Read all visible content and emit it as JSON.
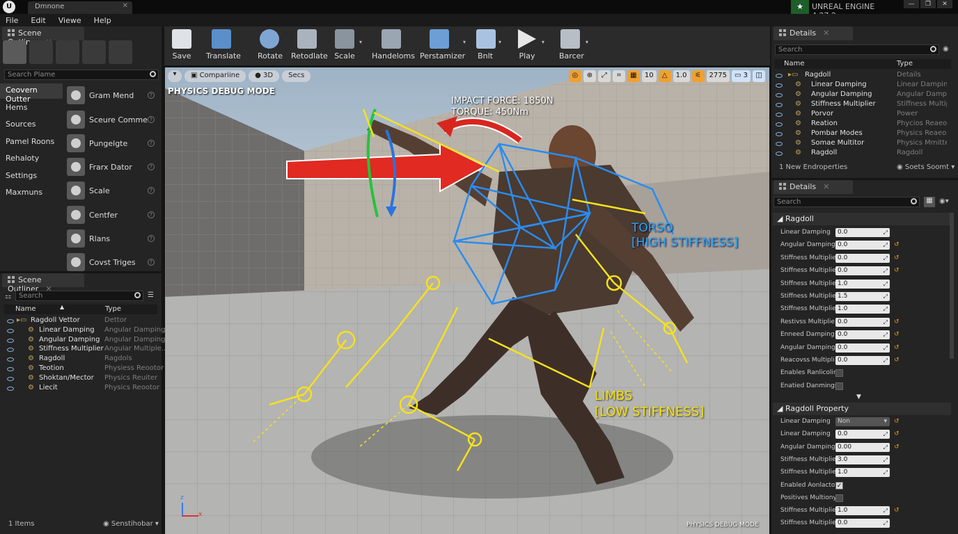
{
  "window": {
    "tab_title": "Dmnone",
    "engine_version": "UNREAL ENGINE 4.27.2"
  },
  "menu": [
    "File",
    "Edit",
    "Viewe",
    "Help"
  ],
  "place_panel": {
    "tab_label": "Scene Outliner",
    "search_placeholder": "Search Plame",
    "categories": [
      "Ceovern Outter",
      "Hems",
      "Sources",
      "Pamel Roons",
      "Rehaloty",
      "Settings",
      "Maxmuns"
    ],
    "items": [
      "Gram Mend",
      "Sceure Comme...",
      "Pungelgte",
      "Frarx Dator",
      "Scale",
      "Centfer",
      "Rlans",
      "Covst Triges"
    ]
  },
  "outliner": {
    "tab_label": "Scene Outliner",
    "search_placeholder": "Search",
    "col_name": "Name",
    "col_type": "Type",
    "rows": [
      {
        "name": "Ragdoll Vettor",
        "type": "Dettor"
      },
      {
        "name": "Linear Damping",
        "type": "Angular Damping"
      },
      {
        "name": "Angular Damping",
        "type": "Angular Damping"
      },
      {
        "name": "Stiffness Multiplier",
        "type": "Angular Multiple..."
      },
      {
        "name": "Ragdoll",
        "type": "Ragdols"
      },
      {
        "name": "Teotion",
        "type": "Physiess Reootor"
      },
      {
        "name": "Shoktan/Mector",
        "type": "Physics Reuiter"
      },
      {
        "name": "Liecit",
        "type": "Physics Reootor"
      }
    ],
    "footer_count": "1 Items",
    "footer_view": "Senstihobar"
  },
  "toolbar": {
    "buttons": [
      "Save",
      "Translate",
      "Rotate",
      "Retodlate",
      "Scale",
      "Handeloms",
      "Perstamizer",
      "Bnlt",
      "Play",
      "Barcer"
    ]
  },
  "viewport": {
    "pill_compare": "Compariine",
    "pill_3d": "3D",
    "pill_secs": "Secs",
    "snap_grid": "10",
    "snap_scale": "1.0",
    "cam_speed": "2775",
    "screen_count": "3",
    "mode_label": "PHYSICS DEBUG MODE",
    "impact_force": "IMPACT FORCE: 1850N",
    "torque": "TORQUE: 450Nm",
    "torso_label_1": "TORSO",
    "torso_label_2": "[HIGH STIFFNESS]",
    "limbs_label_1": "LIMBS",
    "limbs_label_2": "[LOW STIFFNESS]",
    "bottom_label": "PHYSICS DEBUG MODE",
    "axes": [
      "z",
      "x"
    ]
  },
  "details_top": {
    "tab_label": "Details",
    "search_placeholder": "Search",
    "col_name": "Name",
    "col_type": "Type",
    "rows": [
      {
        "name": "Ragdoll",
        "type": "Details"
      },
      {
        "name": "Linear Damping",
        "type": "Linear Damping"
      },
      {
        "name": "Angular Damping",
        "type": "Angular Dampin"
      },
      {
        "name": "Stiffness Multiplier",
        "type": "Stiffness Multipl"
      },
      {
        "name": "Porvor",
        "type": "Power"
      },
      {
        "name": "Reation",
        "type": "Phycios Reaeos"
      },
      {
        "name": "Pombar Modes",
        "type": "Physics Reaeos"
      },
      {
        "name": "Somae Multitor",
        "type": "Physics Mmitter"
      },
      {
        "name": "Ragdoll",
        "type": "Ragdoll"
      }
    ],
    "footer_new": "1 New Endroperties",
    "footer_sort": "Soets Soomt"
  },
  "details_bottom": {
    "tab_label": "Details",
    "search_placeholder": "Search",
    "section_ragdoll": "Ragdoll",
    "ragdoll_rows": [
      {
        "label": "Linear Damping",
        "value": "0.0",
        "kind": "num",
        "reset": false
      },
      {
        "label": "Angular Damping",
        "value": "0.0",
        "kind": "num",
        "reset": true
      },
      {
        "label": "Stiffness Multiplie",
        "value": "0.0",
        "kind": "num",
        "reset": true
      },
      {
        "label": "Stiffness Multiplie",
        "value": "0.0",
        "kind": "num",
        "reset": true
      },
      {
        "label": "Stiffness Multiplie",
        "value": "1.0",
        "kind": "num",
        "reset": false
      },
      {
        "label": "Stiffness Multiplie",
        "value": "1.5",
        "kind": "num",
        "reset": false
      },
      {
        "label": "Stiffness Multiplie",
        "value": "1.0",
        "kind": "num",
        "reset": false
      },
      {
        "label": "Restivss Multiplie",
        "value": "0.0",
        "kind": "num",
        "reset": true
      },
      {
        "label": "Enneed Damping",
        "value": "0.0",
        "kind": "num",
        "reset": true
      },
      {
        "label": "Angular Damping",
        "value": "0.0",
        "kind": "num",
        "reset": true
      },
      {
        "label": "Reacovss Multipli",
        "value": "0.0",
        "kind": "num",
        "reset": true
      },
      {
        "label": "Enables Ranlicolin",
        "value": "",
        "kind": "check",
        "checked": false
      },
      {
        "label": "Enatied Danmings",
        "value": "",
        "kind": "check",
        "checked": false
      }
    ],
    "section_property": "Ragdoll Property",
    "property_rows": [
      {
        "label": "Linear Damping",
        "value": "Non",
        "kind": "drop",
        "reset": true
      },
      {
        "label": "Linear Damping",
        "value": "0.0",
        "kind": "num",
        "reset": true
      },
      {
        "label": "Angular Damping",
        "value": "0.00",
        "kind": "num",
        "reset": true
      },
      {
        "label": "Stiffness Multiplie",
        "value": "3.0",
        "kind": "num",
        "reset": false
      },
      {
        "label": "Stiffness Multiplie",
        "value": "1.0",
        "kind": "num",
        "reset": false
      },
      {
        "label": "Enabled Aonlactor",
        "value": "",
        "kind": "check",
        "checked": true
      },
      {
        "label": "Positives Multiony",
        "value": "",
        "kind": "check",
        "checked": false
      },
      {
        "label": "Stiffness Multiplier",
        "value": "1.0",
        "kind": "num",
        "reset": true
      },
      {
        "label": "Stiffness Multiplie",
        "value": "0.0",
        "kind": "num",
        "reset": false
      }
    ]
  }
}
